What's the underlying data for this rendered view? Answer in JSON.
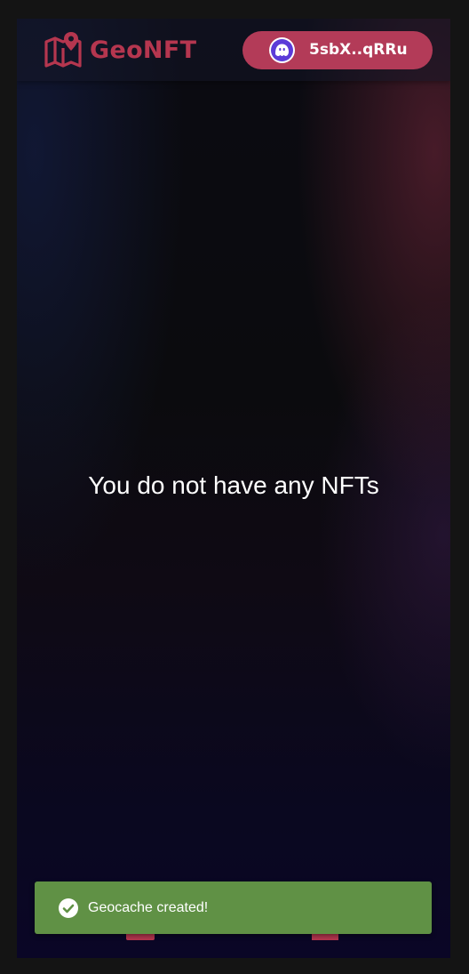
{
  "header": {
    "brand_name": "GeoNFT",
    "logo_icon": "map-pin-icon",
    "wallet": {
      "avatar_icon": "phantom-ghost-icon",
      "address": "5sbX..qRRu"
    }
  },
  "main": {
    "empty_message": "You do not have any NFTs"
  },
  "bottom_nav": {
    "items": [
      {
        "icon": "nft-icon"
      },
      {
        "icon": "map-icon"
      }
    ]
  },
  "toast": {
    "icon": "check-circle-icon",
    "message": "Geocache created!"
  },
  "colors": {
    "brand": "#b5364f",
    "wallet_button": "#b33b58",
    "toast_success": "#609145"
  }
}
